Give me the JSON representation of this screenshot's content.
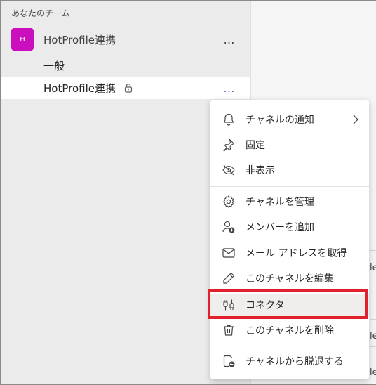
{
  "sidebar": {
    "section_title": "あなたのチーム",
    "team": {
      "avatar_letter": "H",
      "name": "HotProfile連携",
      "avatar_color": "#cb0fbf"
    },
    "channels": [
      {
        "label": "一般"
      },
      {
        "label": "HotProfile連携",
        "selected": true
      }
    ],
    "more_label": "…"
  },
  "menu": {
    "items": [
      {
        "label": "チャネルの通知",
        "icon": "bell-icon",
        "has_submenu": true
      },
      {
        "label": "固定",
        "icon": "pin-icon"
      },
      {
        "label": "非表示",
        "icon": "eye-off-icon"
      },
      {
        "label": "チャネルを管理",
        "icon": "gear-icon"
      },
      {
        "label": "メンバーを追加",
        "icon": "add-person-icon"
      },
      {
        "label": "メール アドレスを取得",
        "icon": "mail-icon"
      },
      {
        "label": "このチャネルを編集",
        "icon": "pencil-icon"
      },
      {
        "label": "コネクタ",
        "icon": "plug-icon",
        "highlighted": true
      },
      {
        "label": "このチャネルを削除",
        "icon": "trash-icon"
      },
      {
        "label": "チャネルから脱退する",
        "icon": "leave-icon"
      }
    ]
  },
  "background_fragments": [
    "le",
    "le",
    "le"
  ],
  "highlight_color": "#e0202a"
}
